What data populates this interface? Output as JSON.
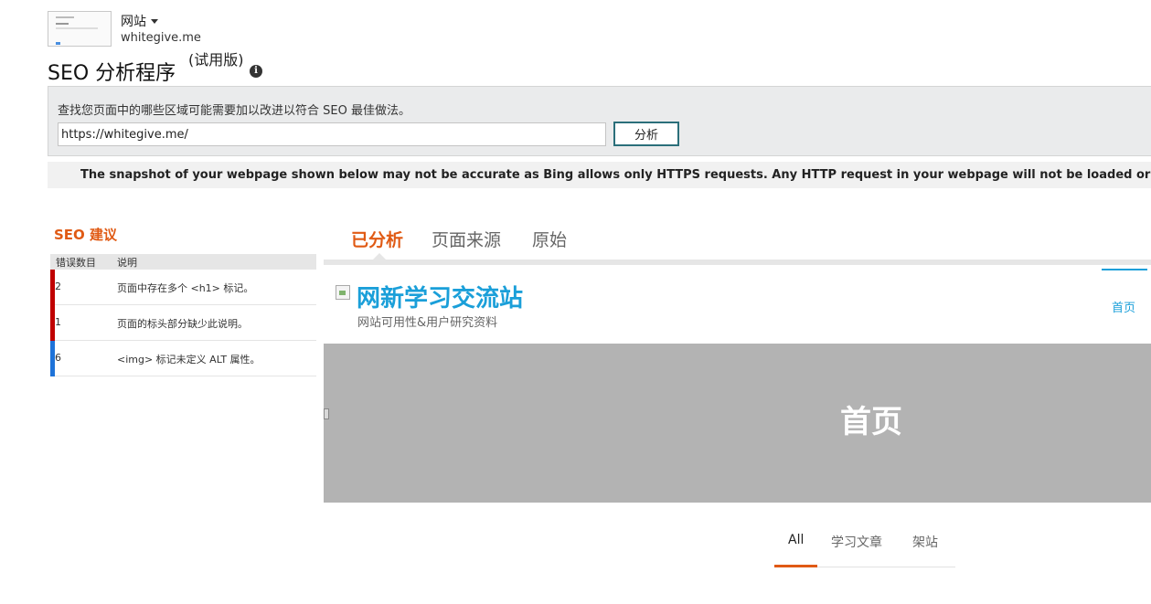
{
  "site": {
    "selector_label": "网站",
    "url": "whitegive.me"
  },
  "header": {
    "title": "SEO 分析程序",
    "title_badge": "(试用版)",
    "info_icon": "i"
  },
  "analyze": {
    "description": "查找您页面中的哪些区域可能需要加以改进以符合 SEO 最佳做法。",
    "url_value": "https://whitegive.me/",
    "button_label": "分析"
  },
  "notice": "The snapshot of your webpage shown below may not be accurate as Bing allows only HTTPS requests. Any HTTP request in your webpage will not be loaded or displayed correctly",
  "suggestions": {
    "title": "SEO 建议",
    "col_count": "错误数目",
    "col_desc": "说明",
    "rows": [
      {
        "count": "2",
        "text": "页面中存在多个 <h1> 标记。",
        "color": "#c00000"
      },
      {
        "count": "1",
        "text": "页面的标头部分缺少此说明。",
        "color": "#c00000"
      },
      {
        "count": "6",
        "text": "<img> 标记未定义 ALT 属性。",
        "color": "#1e73d9"
      }
    ]
  },
  "tabs": [
    {
      "label": "已分析",
      "active": true
    },
    {
      "label": "页面来源",
      "active": false
    },
    {
      "label": "原始",
      "active": false
    }
  ],
  "preview": {
    "logo": "网新学习交流站",
    "tagline": "网站可用性&用户研究资料",
    "nav_item": "首页",
    "banner_title": "首页",
    "categories": [
      {
        "label": "All",
        "active": true
      },
      {
        "label": "学习文章",
        "active": false
      },
      {
        "label": "架站",
        "active": false
      }
    ]
  },
  "colors": {
    "accent": "#e05a14",
    "link": "#1a9fd9",
    "error": "#c00000",
    "info": "#1e73d9"
  }
}
